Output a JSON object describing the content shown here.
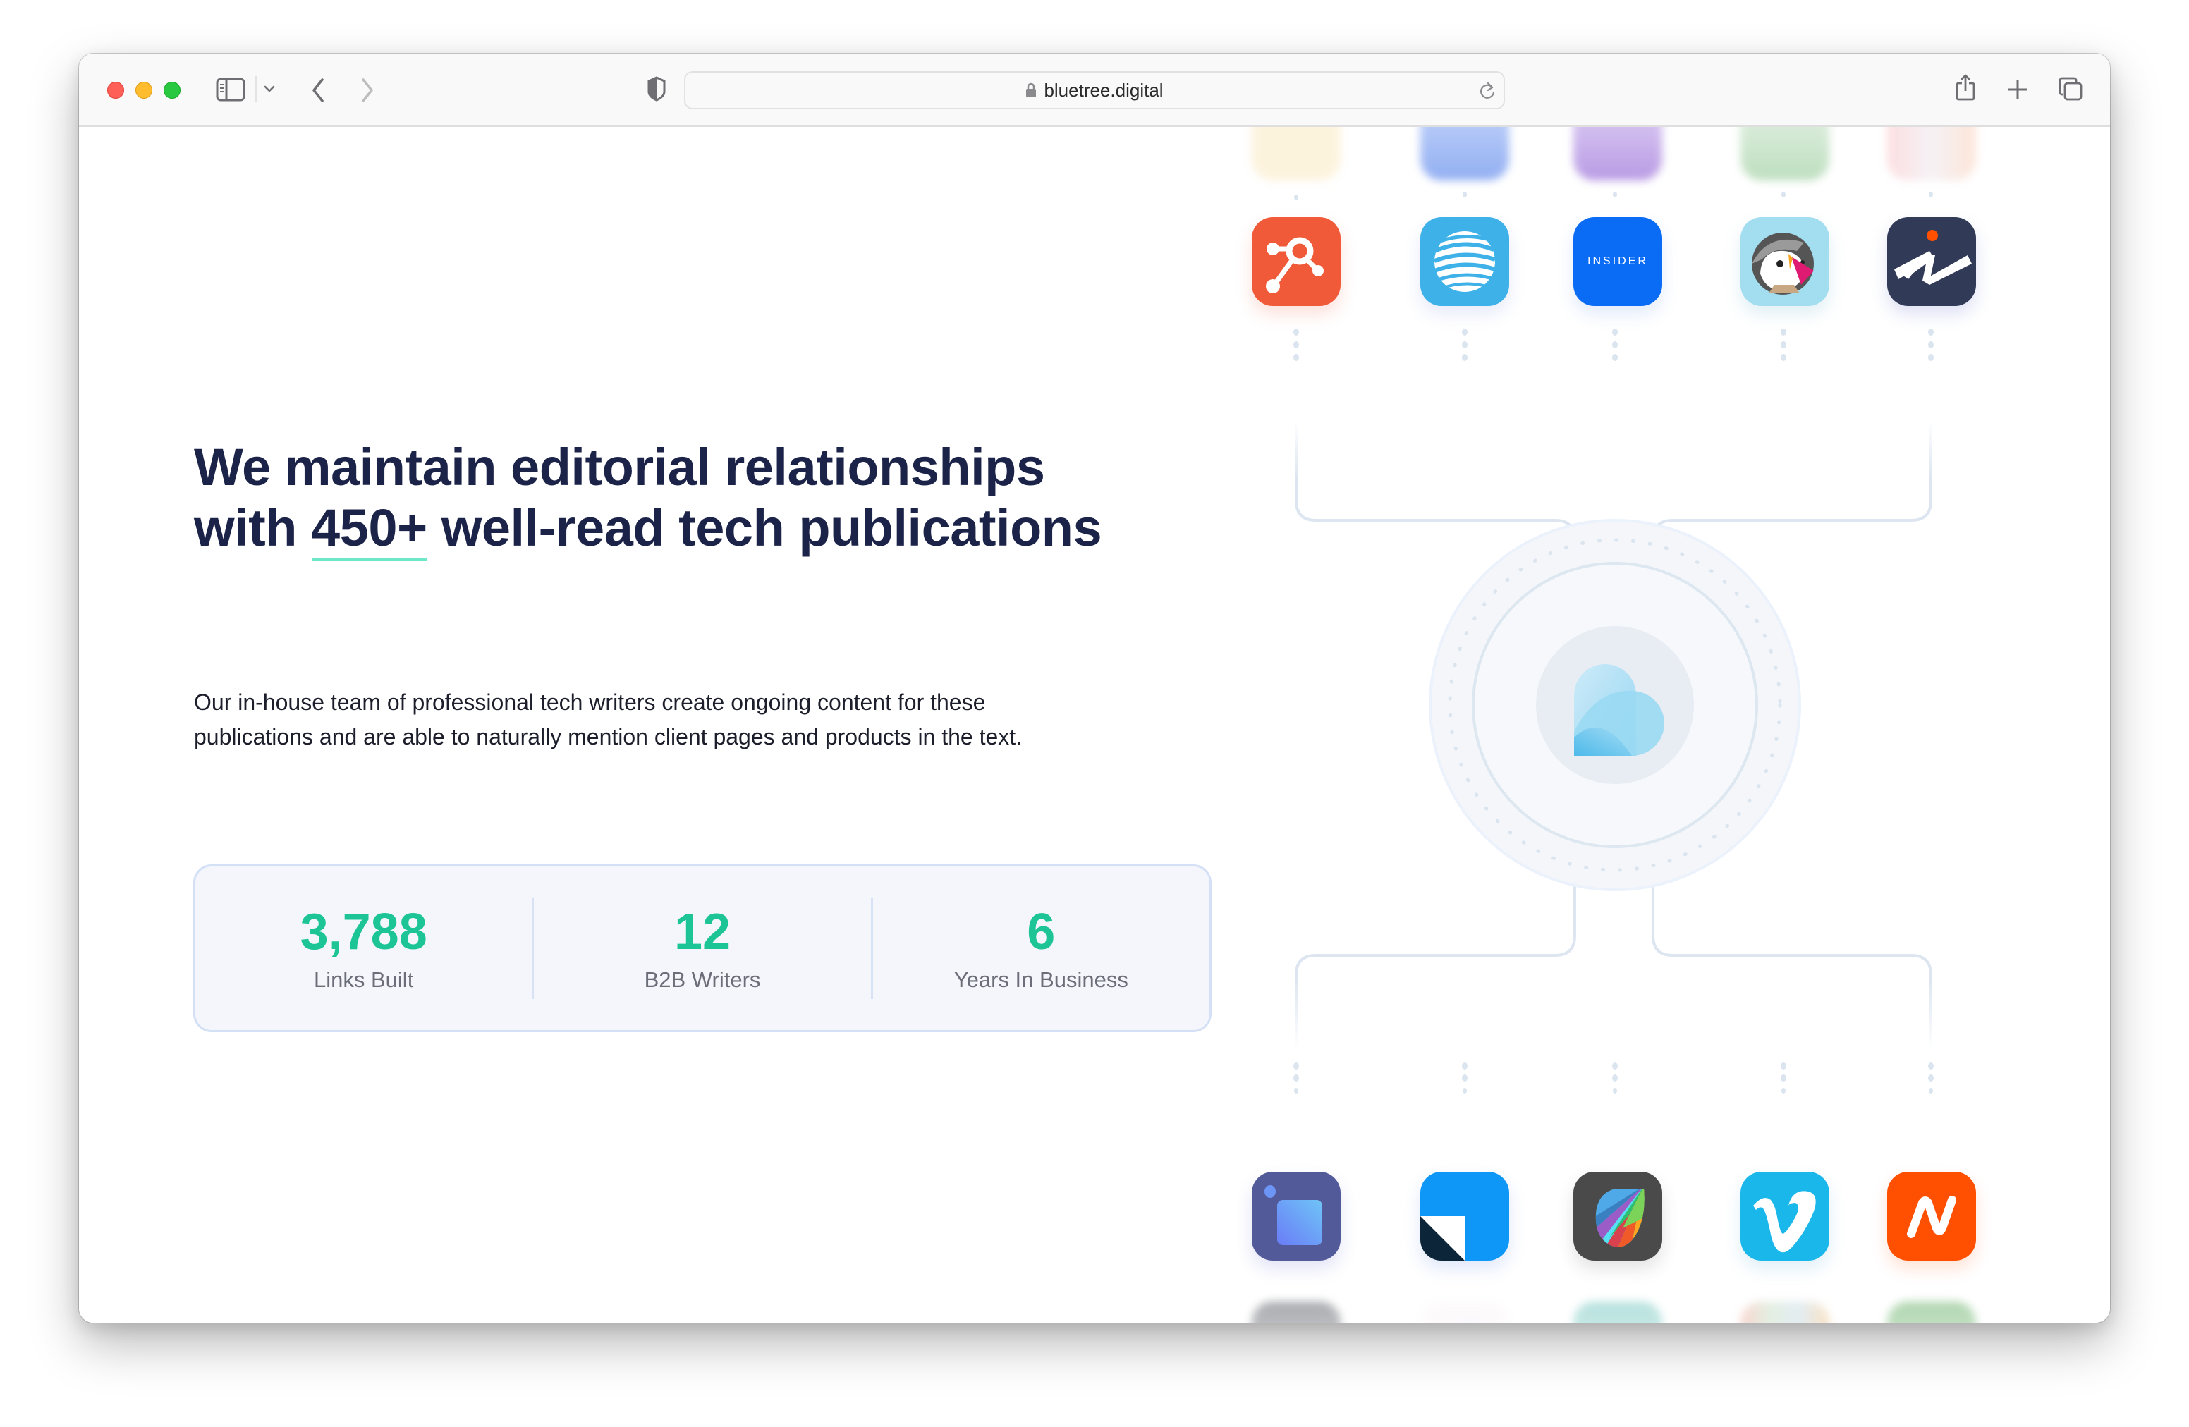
{
  "browser": {
    "url": "bluetree.digital",
    "icons": {
      "sidebar": "sidebar-toggle-icon",
      "tab_overview_menu": "chevron-down-icon",
      "back": "chevron-left-icon",
      "forward": "chevron-right-icon",
      "privacy": "shield-icon",
      "lock": "lock-icon",
      "reload": "reload-icon",
      "share": "share-icon",
      "new_tab": "plus-icon",
      "tabs": "tabs-overview-icon"
    }
  },
  "hero": {
    "heading_line1": "We maintain editorial relationships",
    "heading_line2_prefix": "with ",
    "heading_highlight": "450+",
    "heading_line2_suffix": " well-read tech publications",
    "paragraph_line1": "Our in-house team of professional tech writers create ongoing content for these",
    "paragraph_line2": "publications and are able to naturally mention client pages and products in the text."
  },
  "stats": [
    {
      "value": "3,788",
      "label": "Links Built"
    },
    {
      "value": "12",
      "label": "B2B Writers"
    },
    {
      "value": "6",
      "label": "Years In Business"
    }
  ],
  "colors": {
    "heading": "#1c2349",
    "accent_underline": "#6ee7c8",
    "stat_number": "#1dc596",
    "stat_label": "#6b6e78",
    "card_bg": "#f4f6fb",
    "card_border": "#d3e0f6",
    "connector": "#dde6f0"
  },
  "diagram": {
    "hub_logo": "bluetree-logo",
    "top_faded_icons": [
      "faded-app-icon-cream",
      "faded-app-icon-blue",
      "faded-app-icon-purple",
      "faded-app-icon-green",
      "faded-app-icon-pink"
    ],
    "top_icons": [
      {
        "name": "hubspot-icon",
        "bg": "#f05a38"
      },
      {
        "name": "att-icon",
        "bg": "#3eb1e8"
      },
      {
        "name": "insider-icon",
        "bg": "#0a6cf5",
        "text": "INSIDER"
      },
      {
        "name": "prestashop-icon",
        "bg": "#a3ddf0"
      },
      {
        "name": "zipline-icon",
        "bg": "#313a57"
      }
    ],
    "bottom_icons": [
      {
        "name": "purple-square-app-icon",
        "bg": "#525a9a"
      },
      {
        "name": "blue-fold-app-icon",
        "bg": "#0e97f7"
      },
      {
        "name": "freshbooks-leaf-icon",
        "bg": "#4a4a4a"
      },
      {
        "name": "vimeo-icon",
        "bg": "#1ab7ea"
      },
      {
        "name": "namecheap-icon",
        "bg": "#fe5000"
      }
    ],
    "bottom_faded_icons": [
      "faded-app-icon-gray",
      "faded-app-icon-white",
      "faded-app-icon-teal",
      "faded-app-icon-multicolor",
      "faded-app-icon-green"
    ]
  }
}
